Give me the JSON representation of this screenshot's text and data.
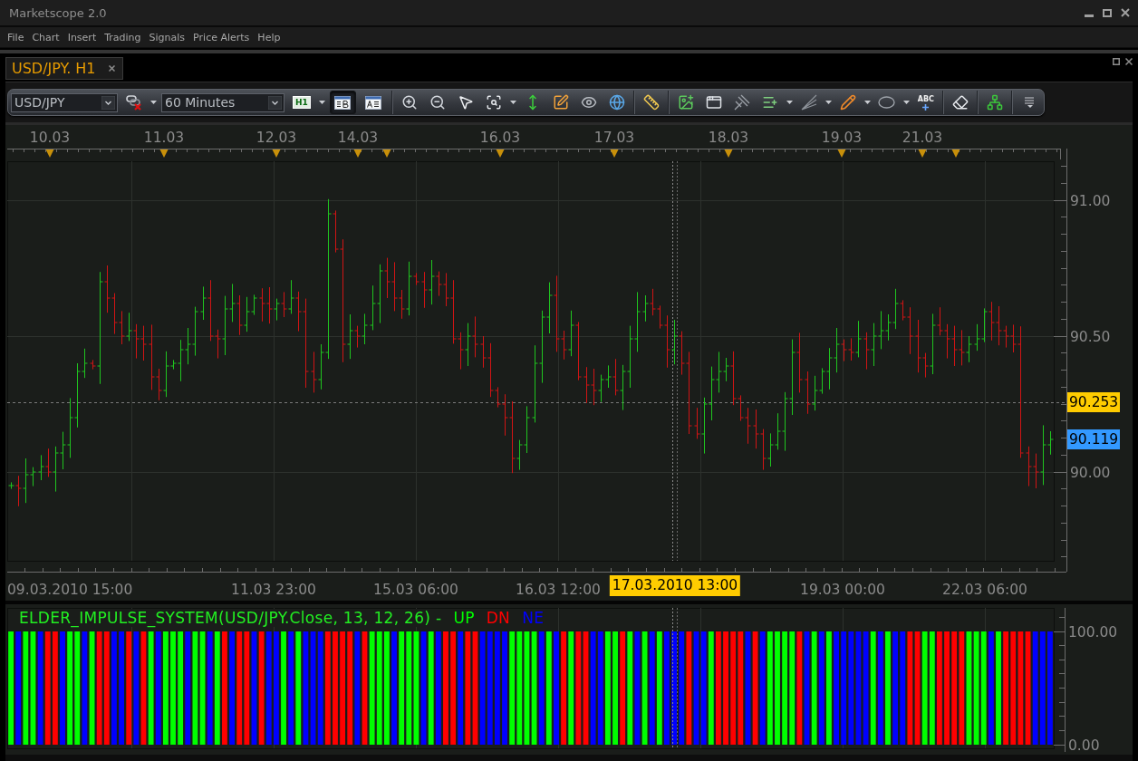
{
  "window": {
    "title": "Marketscope 2.0"
  },
  "menu": [
    "File",
    "Chart",
    "Insert",
    "Trading",
    "Signals",
    "Price Alerts",
    "Help"
  ],
  "tabs": [
    {
      "label": "USD/JPY. H1",
      "selected": true
    }
  ],
  "toolbar": {
    "symbol_select": {
      "value": "USD/JPY"
    },
    "timeframe_select": {
      "value": "60 Minutes"
    },
    "period_button": {
      "label": "H1"
    },
    "view_buttons": [
      {
        "kind": "bars",
        "selected": true
      },
      {
        "kind": "labels",
        "selected": false
      }
    ],
    "text_tool": {
      "label": "ABC"
    }
  },
  "price_chart": {
    "date_labels": [
      "10.03",
      "11.03",
      "12.03",
      "14.03",
      "16.03",
      "17.03",
      "18.03",
      "19.03",
      "21.03"
    ],
    "price_labels": [
      "91.00",
      "90.50",
      "90.00"
    ],
    "time_labels": [
      "09.03.2010 15:00",
      "11.03 23:00",
      "15.03 06:00",
      "16.03 12:00",
      "19.03 00:00",
      "22.03 06:00"
    ],
    "cursor_time": "17.03.2010 13:00",
    "price_tags": [
      {
        "kind": "line",
        "label": "90.253",
        "color": "#ffcc00"
      },
      {
        "kind": "tag",
        "label": "90.119",
        "color": "#3399ff"
      }
    ]
  },
  "indicator_pane": {
    "chart_data": {
      "type": "bar",
      "title": "ELDER_IMPULSE_SYSTEM(USD/JPY.Close, 13, 12, 26) -",
      "stacked": true,
      "grid": true,
      "ylim": [
        -3.2,
        120.8
      ],
      "yticks": [
        {
          "value": 0,
          "label": "0.00"
        },
        {
          "value": 100,
          "label": "100.00"
        }
      ],
      "series": [
        {
          "name": "UP",
          "color": "#00ff00",
          "values": [
            100,
            0,
            100,
            100,
            0,
            0,
            0,
            0,
            100,
            100,
            0,
            100,
            0,
            0,
            0,
            0,
            0,
            0,
            0,
            100,
            0,
            100,
            100,
            100,
            0,
            100,
            100,
            0,
            100,
            0,
            0,
            0,
            0,
            0,
            0,
            0,
            0,
            100,
            0,
            100,
            0,
            0,
            0,
            0,
            0,
            0,
            0,
            0,
            0,
            100,
            100,
            100,
            0,
            100,
            100,
            100,
            0,
            100,
            0,
            0,
            0,
            0,
            0,
            0,
            0,
            0,
            0,
            0,
            100,
            100,
            100,
            100,
            0,
            100,
            0,
            0,
            100,
            0,
            0,
            0,
            0,
            100,
            100,
            0,
            100,
            0,
            100,
            0,
            100,
            0,
            0,
            0,
            0,
            0,
            0,
            100,
            0,
            0,
            0,
            0,
            0,
            0,
            0,
            100,
            100,
            100,
            100,
            0,
            0,
            100,
            0,
            100,
            0,
            0,
            0,
            0,
            0,
            100,
            0,
            100,
            0,
            0,
            0,
            0,
            100,
            100,
            0,
            0,
            0,
            0,
            100,
            100,
            100,
            0,
            100,
            0,
            0,
            0,
            0,
            0,
            0,
            0
          ]
        },
        {
          "name": "DN",
          "color": "#ff0000",
          "values": [
            0,
            0,
            0,
            0,
            0,
            100,
            100,
            0,
            0,
            0,
            0,
            0,
            100,
            100,
            0,
            0,
            100,
            0,
            100,
            0,
            0,
            0,
            0,
            0,
            0,
            0,
            0,
            0,
            0,
            100,
            0,
            100,
            100,
            0,
            100,
            0,
            0,
            0,
            0,
            0,
            0,
            0,
            0,
            100,
            100,
            100,
            100,
            0,
            100,
            0,
            0,
            0,
            0,
            0,
            0,
            0,
            0,
            0,
            0,
            100,
            100,
            0,
            100,
            100,
            0,
            0,
            0,
            0,
            0,
            0,
            0,
            0,
            0,
            0,
            0,
            100,
            0,
            100,
            100,
            0,
            0,
            0,
            0,
            100,
            0,
            0,
            0,
            0,
            0,
            0,
            0,
            0,
            100,
            0,
            0,
            0,
            100,
            100,
            100,
            100,
            0,
            100,
            0,
            0,
            0,
            0,
            0,
            100,
            0,
            0,
            0,
            0,
            0,
            0,
            0,
            0,
            0,
            0,
            0,
            0,
            0,
            0,
            100,
            100,
            0,
            0,
            100,
            100,
            100,
            100,
            0,
            0,
            0,
            0,
            0,
            100,
            100,
            100,
            100,
            0,
            0,
            0
          ]
        },
        {
          "name": "NE",
          "color": "#0000ff",
          "values": [
            0,
            100,
            0,
            0,
            100,
            0,
            0,
            100,
            0,
            0,
            100,
            0,
            0,
            0,
            100,
            100,
            0,
            100,
            0,
            0,
            100,
            0,
            0,
            0,
            100,
            0,
            0,
            100,
            0,
            0,
            100,
            0,
            0,
            100,
            0,
            100,
            100,
            0,
            100,
            0,
            100,
            100,
            100,
            0,
            0,
            0,
            0,
            100,
            0,
            0,
            0,
            0,
            100,
            0,
            0,
            0,
            100,
            0,
            100,
            0,
            0,
            100,
            0,
            0,
            100,
            100,
            100,
            100,
            0,
            0,
            0,
            0,
            100,
            0,
            100,
            0,
            0,
            0,
            0,
            100,
            100,
            0,
            0,
            0,
            0,
            100,
            0,
            100,
            0,
            100,
            100,
            100,
            0,
            100,
            100,
            0,
            0,
            0,
            0,
            0,
            100,
            0,
            100,
            0,
            0,
            0,
            0,
            0,
            100,
            0,
            100,
            0,
            100,
            100,
            100,
            100,
            100,
            0,
            100,
            0,
            100,
            100,
            0,
            0,
            0,
            0,
            0,
            0,
            0,
            0,
            0,
            0,
            0,
            100,
            0,
            0,
            0,
            0,
            0,
            100,
            100,
            100
          ]
        }
      ]
    }
  }
}
